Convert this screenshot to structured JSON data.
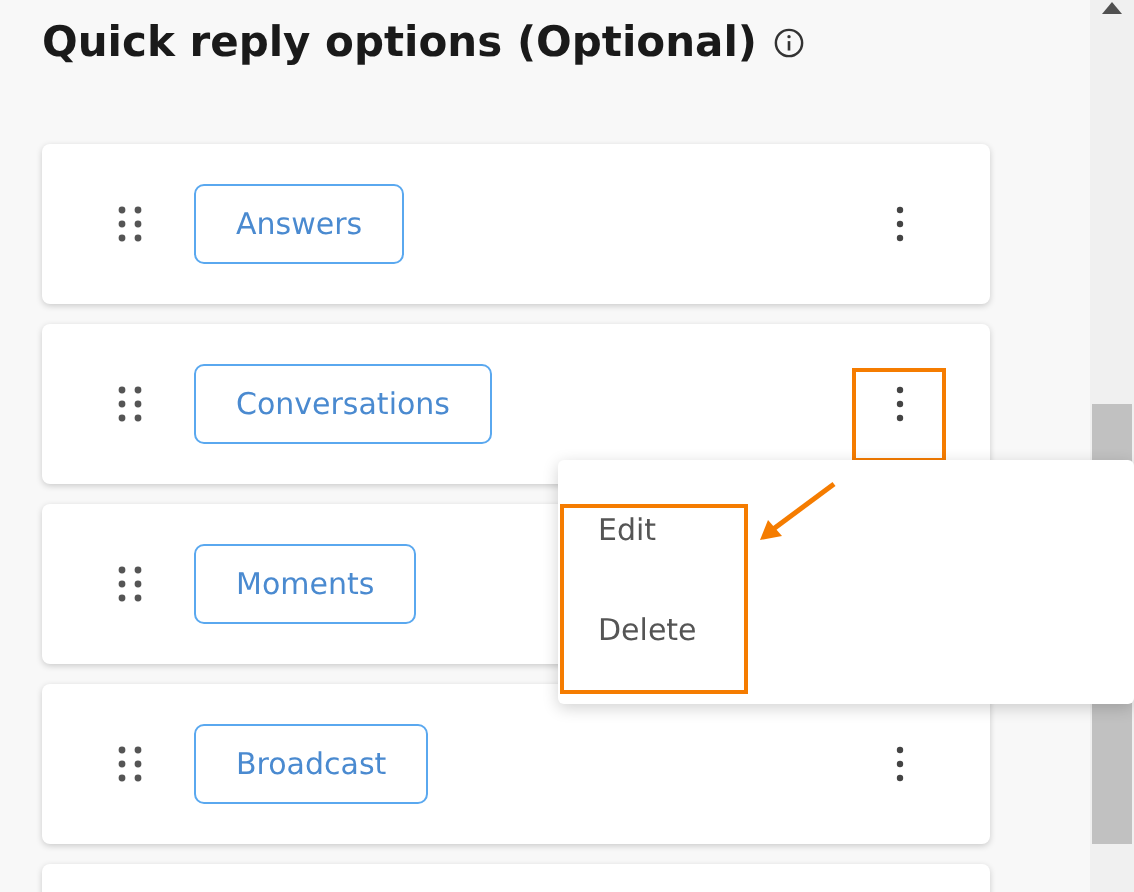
{
  "title": "Quick reply options (Optional)",
  "cards": [
    {
      "kind": "option",
      "label": "Answers",
      "highlighted": false
    },
    {
      "kind": "option",
      "label": "Conversations",
      "highlighted": true
    },
    {
      "kind": "option",
      "label": "Moments",
      "highlighted": false
    },
    {
      "kind": "option",
      "label": "Broadcast",
      "highlighted": false
    },
    {
      "kind": "partial"
    }
  ],
  "menu": {
    "items": [
      "Edit",
      "Delete"
    ],
    "highlighted": true
  }
}
